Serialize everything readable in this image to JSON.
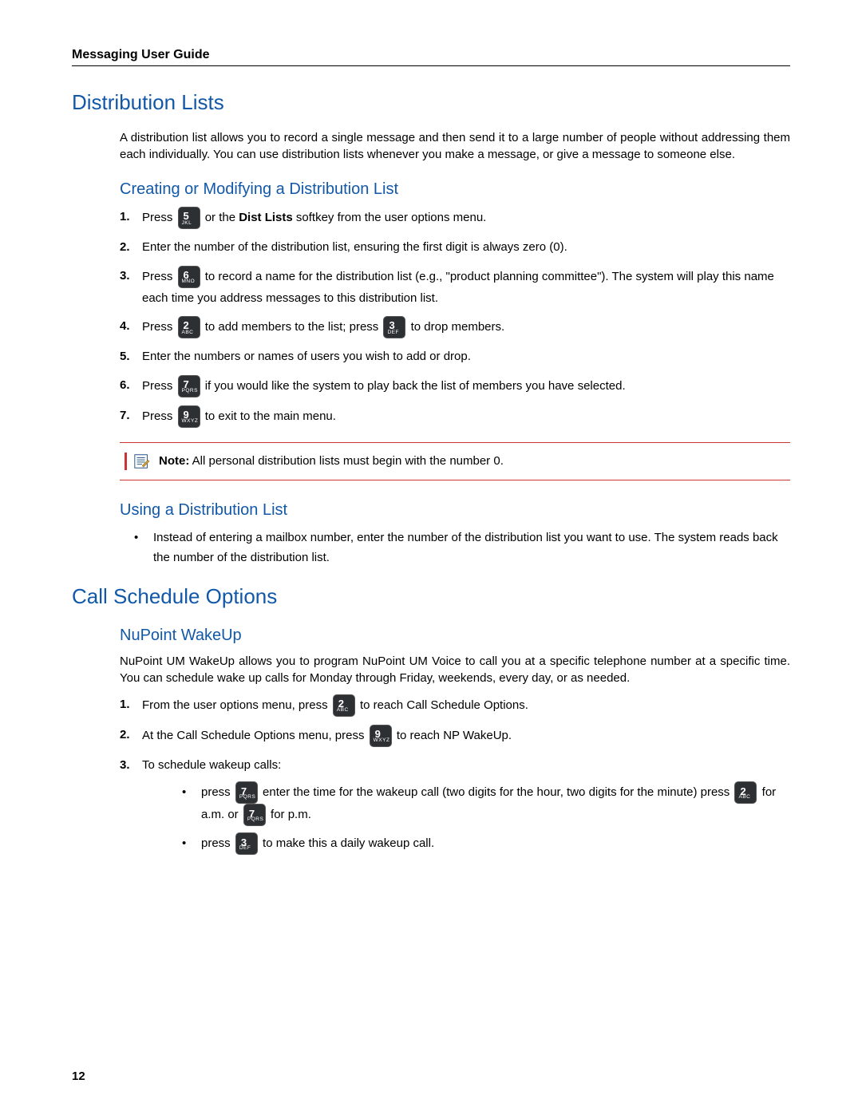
{
  "doc_title": "Messaging User Guide",
  "page_number": "12",
  "sections": {
    "dist_lists": {
      "heading": "Distribution Lists",
      "intro": "A distribution list allows you to record a single message and then send it to a large number of people without addressing them each individually. You can use distribution lists whenever you make a message, or give a message to someone else.",
      "create": {
        "heading": "Creating or Modifying a Distribution List",
        "steps": {
          "s1_a": "Press ",
          "s1_b": " or the ",
          "s1_bold": "Dist Lists",
          "s1_c": " softkey from the user options menu.",
          "s2": "Enter the number of the distribution list, ensuring the first digit is always zero (0).",
          "s3_a": "Press ",
          "s3_b": " to record a name for the distribution list (e.g., \"product planning committee\"). The system will play this name each time you address messages to this distribution list.",
          "s4_a": "Press ",
          "s4_b": " to add members to the list; press ",
          "s4_c": " to drop members.",
          "s5": "Enter the numbers or names of users you wish to add or drop.",
          "s6_a": "Press ",
          "s6_b": " if you would like the system to play back the list of members you have selected.",
          "s7_a": "Press ",
          "s7_b": " to exit to the main menu."
        },
        "note_label": "Note:",
        "note_text": " All personal distribution lists must begin with the number 0."
      },
      "using": {
        "heading": "Using a Distribution List",
        "bullet": "Instead of entering a mailbox number, enter the number of the distribution list you want to use. The system reads back the number of the distribution list."
      }
    },
    "call_sched": {
      "heading": "Call Schedule Options",
      "wakeup": {
        "heading": "NuPoint WakeUp",
        "intro": "NuPoint UM WakeUp allows you to program NuPoint UM Voice to call you at a specific telephone number at a specific time. You can schedule wake up calls for Monday through Friday, weekends, every day, or as needed.",
        "steps": {
          "s1_a": "From the user options menu, press ",
          "s1_b": " to reach Call Schedule Options.",
          "s2_a": "At the Call Schedule Options menu, press ",
          "s2_b": " to reach NP WakeUp.",
          "s3": "To schedule wakeup calls:",
          "sb1_a": "press ",
          "sb1_b": " enter the time for the wakeup call (two digits for the hour, two digits for the minute) press ",
          "sb1_c": " for a.m. or ",
          "sb1_d": " for p.m.",
          "sb2_a": "press ",
          "sb2_b": " to make this a daily wakeup call."
        }
      }
    }
  },
  "keys": {
    "2": {
      "digit": "2",
      "letters": "ABC"
    },
    "3": {
      "digit": "3",
      "letters": "DEF"
    },
    "5": {
      "digit": "5",
      "letters": "JKL"
    },
    "6": {
      "digit": "6",
      "letters": "MNO"
    },
    "7": {
      "digit": "7",
      "letters": "PQRS"
    },
    "9": {
      "digit": "9",
      "letters": "WXYZ"
    }
  }
}
